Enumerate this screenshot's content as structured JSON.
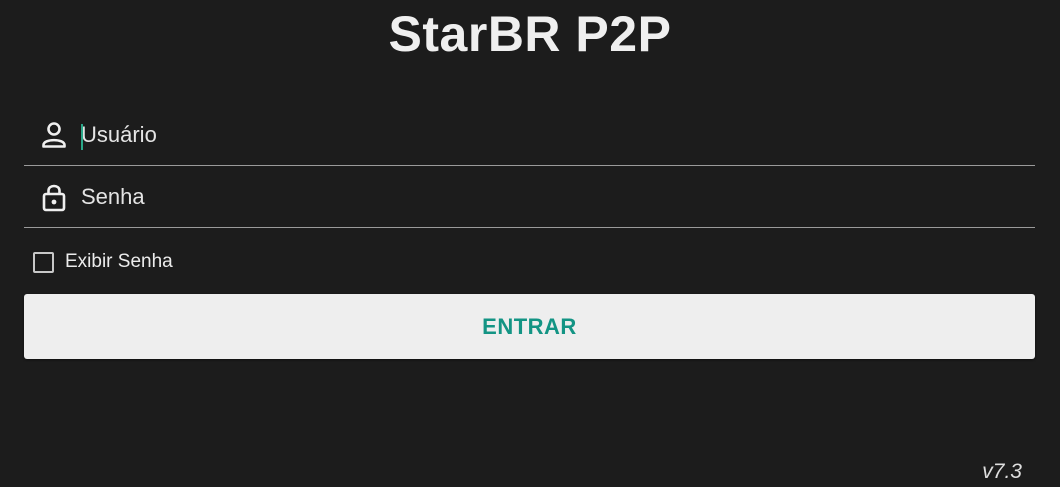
{
  "app": {
    "title": "StarBR P2P",
    "version": "v7.3"
  },
  "form": {
    "username": {
      "placeholder": "Usuário",
      "value": "",
      "icon": "person-icon"
    },
    "password": {
      "placeholder": "Senha",
      "value": "",
      "icon": "lock-icon"
    },
    "show_password": {
      "label": "Exibir Senha",
      "checked": false
    },
    "submit_label": "ENTRAR"
  },
  "colors": {
    "background": "#1c1c1c",
    "button_background": "#eeeeee",
    "button_text": "#139484",
    "caret": "#2aa889",
    "divider": "#9a9a9a"
  }
}
